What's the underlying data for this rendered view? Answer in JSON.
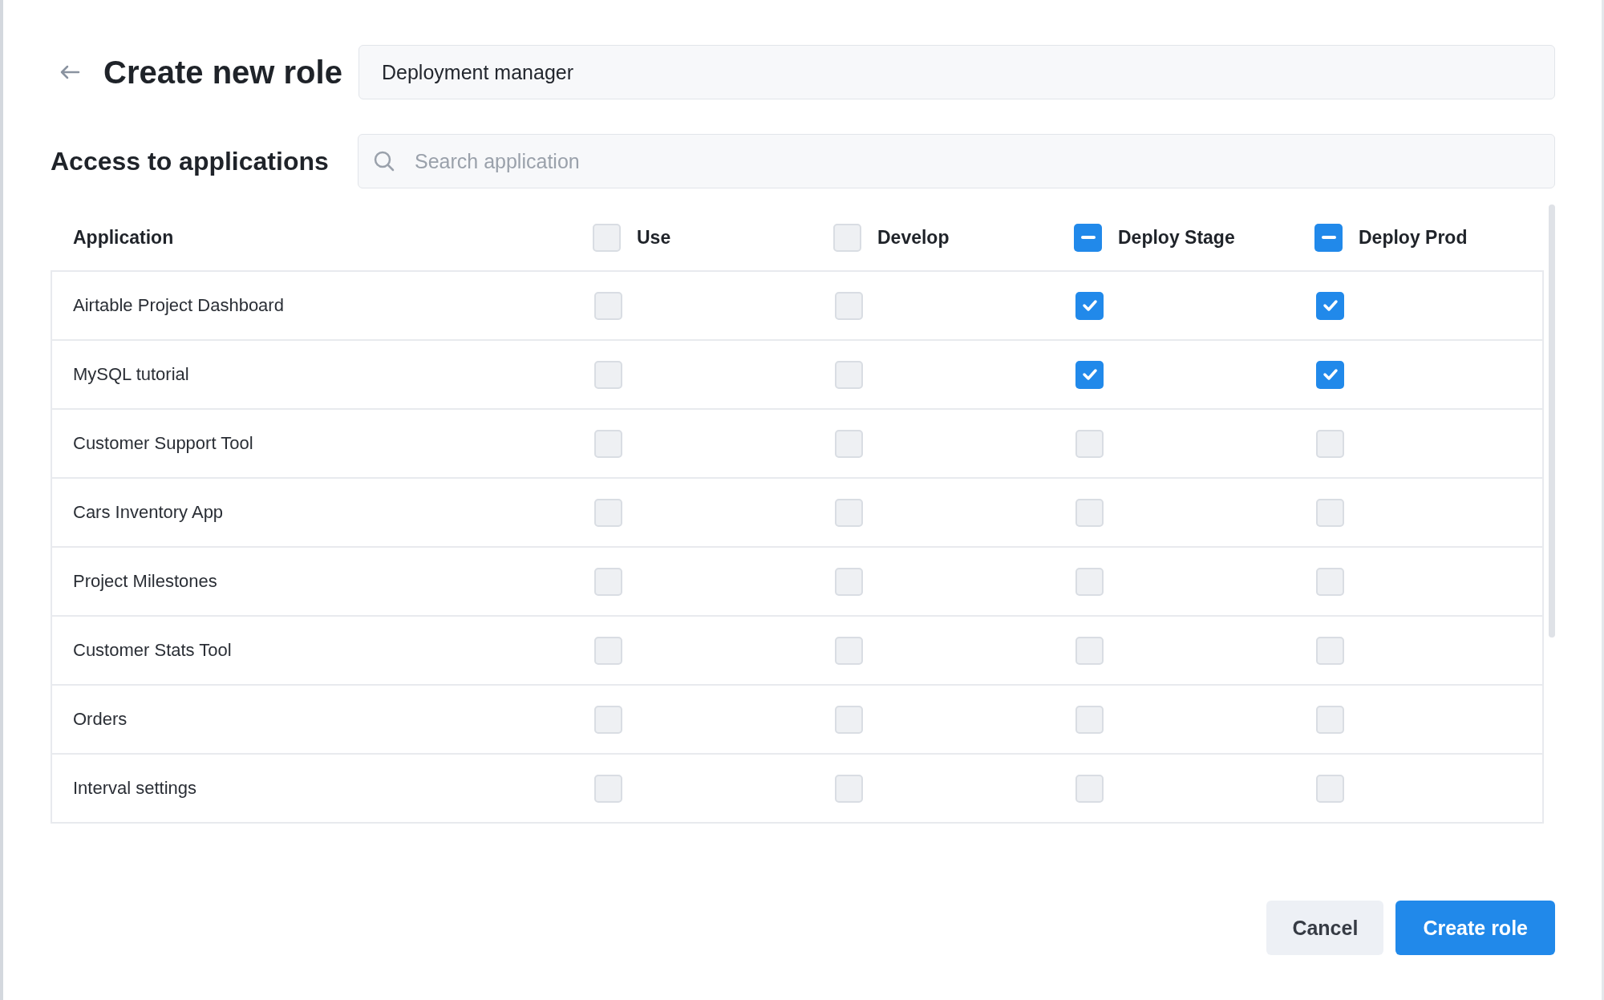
{
  "header": {
    "title": "Create new role",
    "role_name": {
      "value": "Deployment manager"
    }
  },
  "access": {
    "title": "Access to applications",
    "search": {
      "placeholder": "Search application"
    }
  },
  "table": {
    "columns": [
      {
        "label": "Application"
      },
      {
        "label": "Use",
        "mixed": false
      },
      {
        "label": "Develop",
        "mixed": false
      },
      {
        "label": "Deploy Stage",
        "mixed": true
      },
      {
        "label": "Deploy Prod",
        "mixed": true
      }
    ],
    "rows": [
      {
        "name": "Airtable Project Dashboard",
        "checks": [
          false,
          false,
          true,
          true
        ]
      },
      {
        "name": "MySQL tutorial",
        "checks": [
          false,
          false,
          true,
          true
        ]
      },
      {
        "name": "Customer Support Tool",
        "checks": [
          false,
          false,
          false,
          false
        ]
      },
      {
        "name": "Cars Inventory App",
        "checks": [
          false,
          false,
          false,
          false
        ]
      },
      {
        "name": "Project Milestones",
        "checks": [
          false,
          false,
          false,
          false
        ]
      },
      {
        "name": "Customer Stats Tool",
        "checks": [
          false,
          false,
          false,
          false
        ]
      },
      {
        "name": "Orders",
        "checks": [
          false,
          false,
          false,
          false
        ]
      },
      {
        "name": "Interval settings",
        "checks": [
          false,
          false,
          false,
          false
        ]
      }
    ]
  },
  "buttons": [
    {
      "label": "Cancel",
      "kind": "secondary"
    },
    {
      "label": "Create role",
      "kind": "primary"
    }
  ]
}
